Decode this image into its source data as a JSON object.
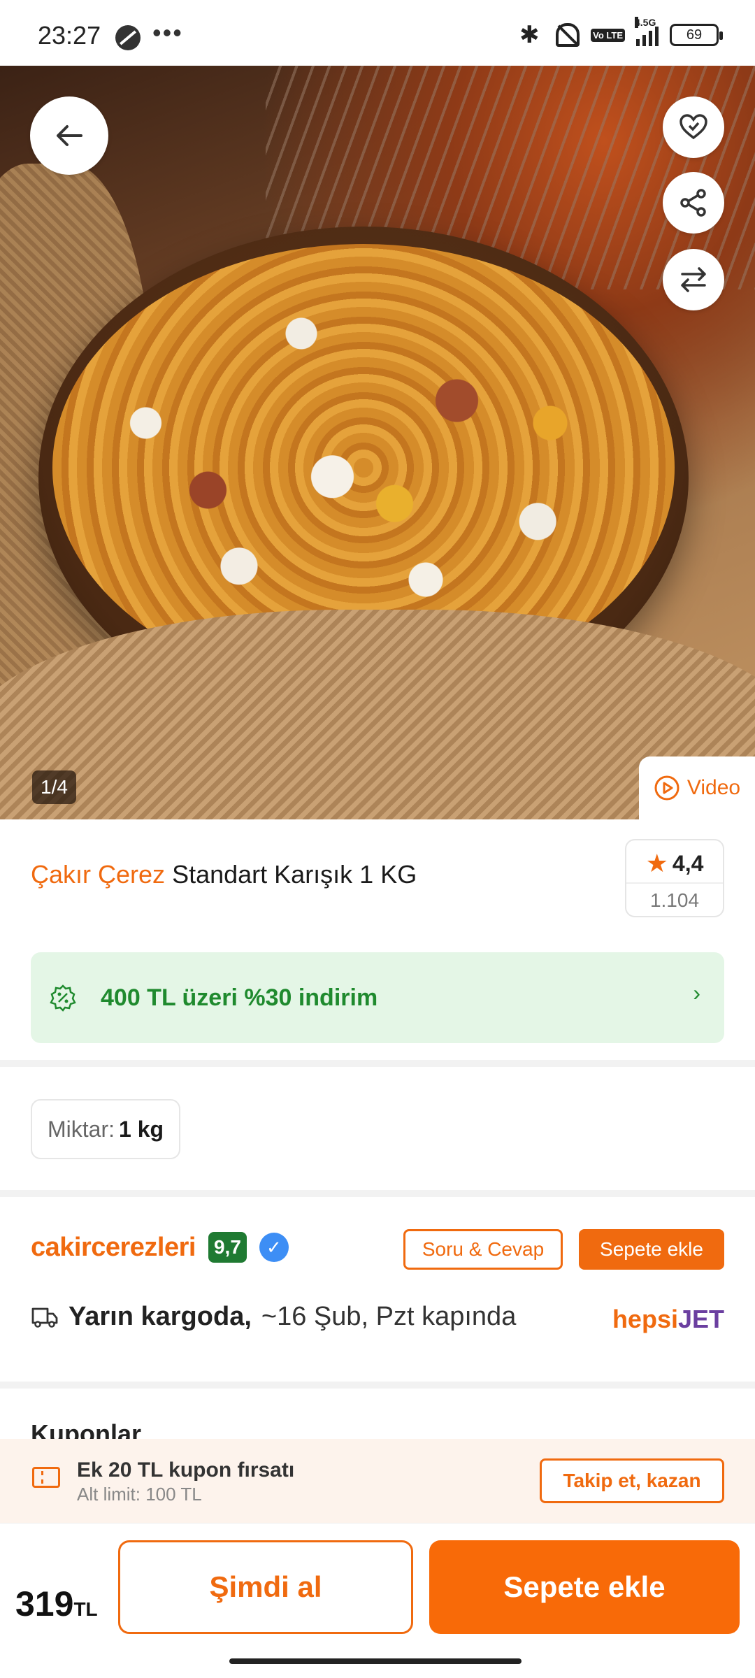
{
  "status_bar": {
    "time": "23:27",
    "dots": "•••",
    "network": "4.5G",
    "volte": "Vo LTE",
    "battery": "69"
  },
  "hero": {
    "counter": "1/4",
    "video_label": "Video",
    "icons": [
      "back-arrow-icon",
      "favorite-heart-icon",
      "share-icon",
      "compare-icon"
    ]
  },
  "product": {
    "brand": "Çakır Çerez",
    "name": "Standart Karışık 1 KG",
    "rating": "4,4",
    "rating_count": "1.104"
  },
  "promo": {
    "text": "400 TL üzeri %30 indirim",
    "arrow": "›"
  },
  "quantity": {
    "label": "Miktar:",
    "value": "1 kg"
  },
  "seller": {
    "name": "cakircerezleri",
    "score": "9,7",
    "qa_label": "Soru & Cevap",
    "add_to_cart_label": "Sepete ekle"
  },
  "delivery": {
    "strong": "Yarın kargoda,",
    "rest": "~16 Şub, Pzt kapında",
    "carrier_a": "hepsi",
    "carrier_b": "JET"
  },
  "coupons": {
    "title": "Kuponlar",
    "offer": "Ek 20 TL kupon fırsatı",
    "limit": "Alt limit: 100 TL",
    "follow_label": "Takip et, kazan"
  },
  "bottom": {
    "price": "319",
    "currency": "TL",
    "buy_now": "Şimdi al",
    "add_to_cart": "Sepete ekle"
  },
  "colors": {
    "accent": "#f06a0f",
    "promo_bg": "#e4f6e6",
    "promo_text": "#1f8a2e",
    "seller_score_bg": "#1f7a32",
    "verified_blue": "#3d8ef5"
  }
}
